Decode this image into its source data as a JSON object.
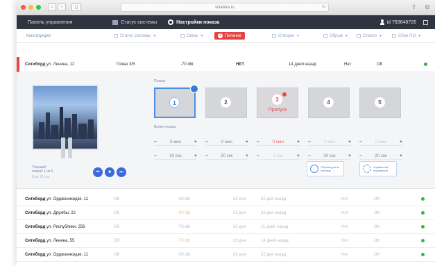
{
  "browser": {
    "url": "sciatera.ru"
  },
  "topnav": {
    "panel": "Панель управления",
    "status": "Статус системы",
    "settings": "Настройки показа",
    "user_id": "id 783648726"
  },
  "toolbar": {
    "title": "Конструкция",
    "status": "Статус системы",
    "link": "Связь",
    "power_count": "1",
    "power": "Питание",
    "shutters": "Створки",
    "heating": "Обрыв",
    "glass": "Стекло",
    "by": "Сбои ПО"
  },
  "active_row": {
    "name_bold": "Ситиборд",
    "name_rest": "ул. Ленина, 12",
    "show": "Показ 3/5",
    "signal": "-70 dbi",
    "power": "НЕТ",
    "last": "14 дней назад",
    "shutter": "Нет",
    "glass": "OK"
  },
  "detail": {
    "plakat_label": "Плакат",
    "posters": [
      "1",
      "2",
      "3",
      "4",
      "5"
    ],
    "skip_label": "Пропуск",
    "time_label": "Время показа",
    "rows": [
      [
        "0 мин",
        "0 мин",
        "0 мин",
        "0 мин",
        "0 мин"
      ],
      [
        "10 сек",
        "20 сек",
        "0 сек",
        "20 сек",
        "20 сек"
      ]
    ],
    "minus": "–",
    "plus": "+",
    "current_label_1": "Текущий",
    "current_label_2": "плакат 1 из 5",
    "current_sub": "8 из 10 сек",
    "reload_label_1": "Перезагрузить",
    "reload_label_2": "систему",
    "light_label_1": "Управление",
    "light_label_2": "подсветкой"
  },
  "rows": [
    {
      "bold": "Ситиборд",
      "rest": "ул. Орджоникидзе, 11",
      "status": "OK",
      "signal": "-59 dbi",
      "days": "83 дня",
      "last": "22 дня назад",
      "shutter": "Нет",
      "glass": "OK"
    },
    {
      "bold": "Ситиборд",
      "rest": "ул. Дружбы, 22",
      "status": "OK",
      "signal": "-90 dbi",
      "days": "22 дня",
      "last": "33 дня назад",
      "shutter": "Нет",
      "glass": "OK"
    },
    {
      "bold": "Ситиборд",
      "rest": "ул. Республики, 256",
      "status": "OK",
      "signal": "-78 dbi",
      "days": "32 дня",
      "last": "11 дней назад",
      "shutter": "Нет",
      "glass": "OK"
    },
    {
      "bold": "Ситиборд",
      "rest": "ул. Ленина, 55",
      "status": "OK",
      "signal": "-70 dbi",
      "days": "23 дня",
      "last": "14 дней назад",
      "shutter": "Нет",
      "glass": "OK"
    },
    {
      "bold": "Ситиборд",
      "rest": "ул. Орджоникидзе, 11",
      "status": "OK",
      "signal": "-59 dbi",
      "days": "83 дня",
      "last": "22 дня назад",
      "shutter": "Нет",
      "glass": "OK"
    }
  ],
  "colors": {
    "accent": "#3a7bd5",
    "alert": "#e84646",
    "ok": "#38b24a",
    "nav": "#2f3441"
  }
}
